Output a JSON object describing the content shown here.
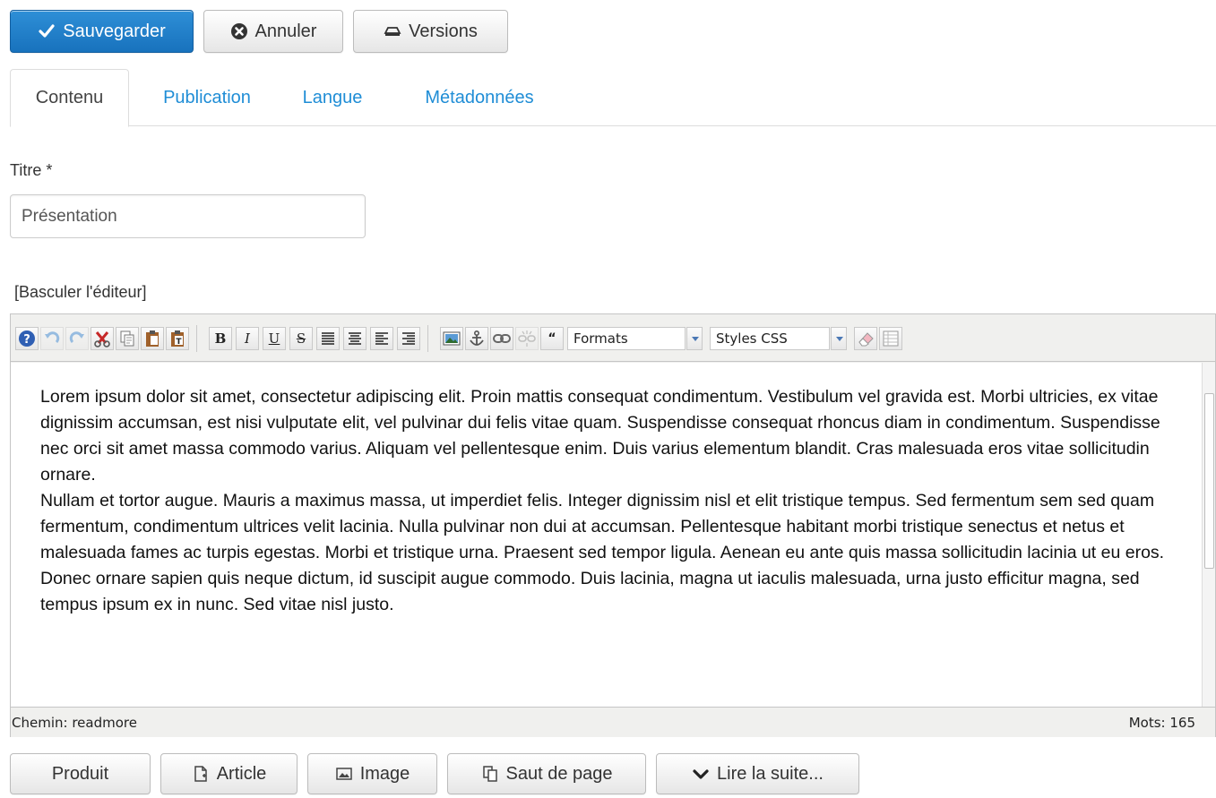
{
  "actions": {
    "save_label": "Sauvegarder",
    "cancel_label": "Annuler",
    "versions_label": "Versions"
  },
  "tabs": [
    {
      "label": "Contenu",
      "active": true
    },
    {
      "label": "Publication",
      "active": false
    },
    {
      "label": "Langue",
      "active": false
    },
    {
      "label": "Métadonnées",
      "active": false
    }
  ],
  "form": {
    "title_label": "Titre *",
    "title_value": "Présentation",
    "toggle_editor": "[Basculer l'éditeur]"
  },
  "editor": {
    "formats_label": "Formats",
    "styles_label": "Styles CSS",
    "paragraphs": [
      "Lorem ipsum dolor sit amet, consectetur adipiscing elit. Proin mattis consequat condimentum. Vestibulum vel gravida est. Morbi ultricies, ex vitae dignissim accumsan, est nisi vulputate elit, vel pulvinar dui felis vitae quam. Suspendisse consequat rhoncus diam in condimentum. Suspendisse nec orci sit amet massa commodo varius. Aliquam vel pellentesque enim. Duis varius elementum blandit. Cras malesuada eros vitae sollicitudin ornare.",
      "Nullam et tortor augue. Mauris a maximus massa, ut imperdiet felis. Integer dignissim nisl et elit tristique tempus. Sed fermentum sem sed quam fermentum, condimentum ultrices velit lacinia. Nulla pulvinar non dui at accumsan. Pellentesque habitant morbi tristique senectus et netus et malesuada fames ac turpis egestas. Morbi et tristique urna. Praesent sed tempor ligula. Aenean eu ante quis massa sollicitudin lacinia ut eu eros. Donec ornare sapien quis neque dictum, id suscipit augue commodo. Duis lacinia, magna ut iaculis malesuada, urna justo efficitur magna, sed tempus ipsum ex in nunc. Sed vitae nisl justo."
    ],
    "status_path": "Chemin: readmore",
    "status_words": "Mots: 165"
  },
  "insert_buttons": {
    "product_label": "Produit",
    "article_label": "Article",
    "image_label": "Image",
    "pagebreak_label": "Saut de page",
    "readmore_label": "Lire la suite..."
  },
  "colors": {
    "primary": "#1f7fcf",
    "link": "#1f8dd6",
    "border": "#c5c5c5"
  }
}
